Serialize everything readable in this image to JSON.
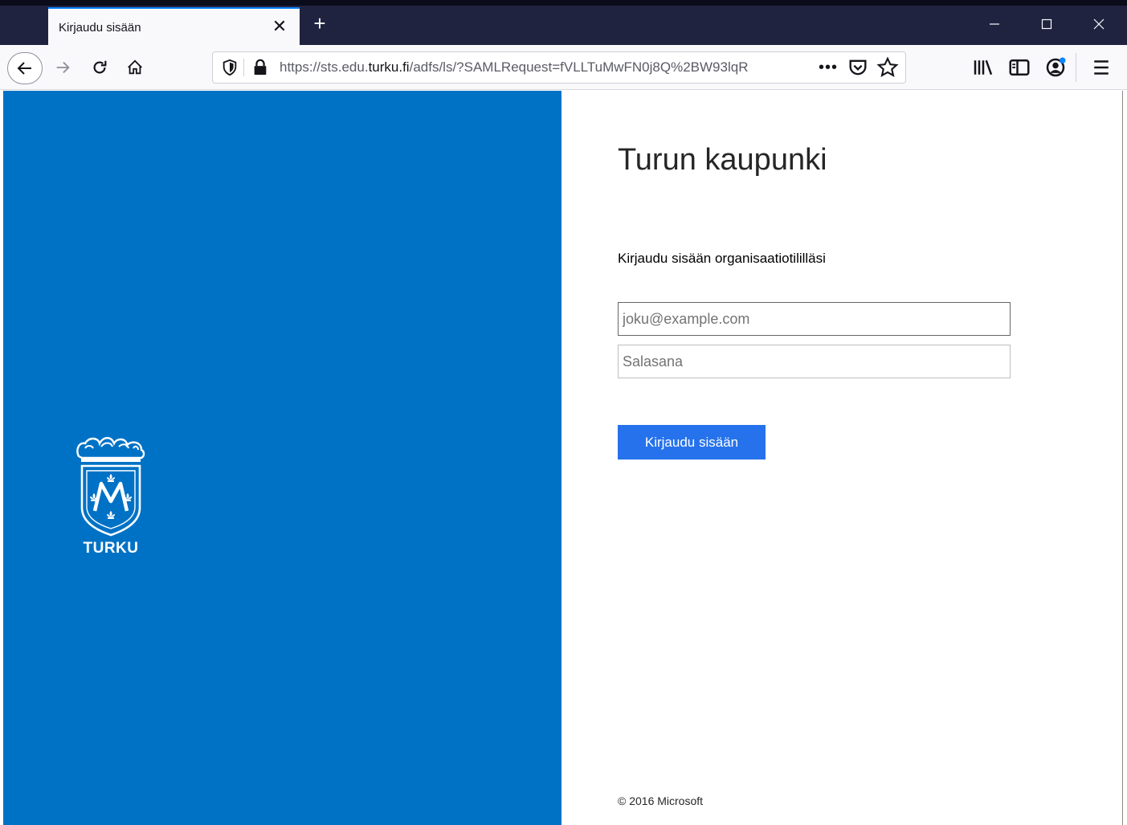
{
  "browser": {
    "tab_title": "Kirjaudu sisään",
    "tab_close": "✕",
    "new_tab": "+",
    "minimize": "—",
    "maximize": "☐",
    "close": "✕",
    "url_scheme": "https://sts.edu.",
    "url_host": "turku.fi",
    "url_path": "/adfs/ls/?SAMLRequest=fVLLTuMwFN0j8Q%2BW93lqR",
    "page_actions_label": "•••"
  },
  "branding": {
    "logo_text": "TURKU",
    "panel_color": "#0072c6"
  },
  "login": {
    "org_name": "Turun kaupunki",
    "prompt": "Kirjaudu sisään organisaatiotililläsi",
    "username_placeholder": "joku@example.com",
    "username_value": "",
    "password_placeholder": "Salasana",
    "password_value": "",
    "submit_label": "Kirjaudu sisään",
    "submit_color": "#2672ec"
  },
  "footer": {
    "copyright": "© 2016 Microsoft"
  }
}
